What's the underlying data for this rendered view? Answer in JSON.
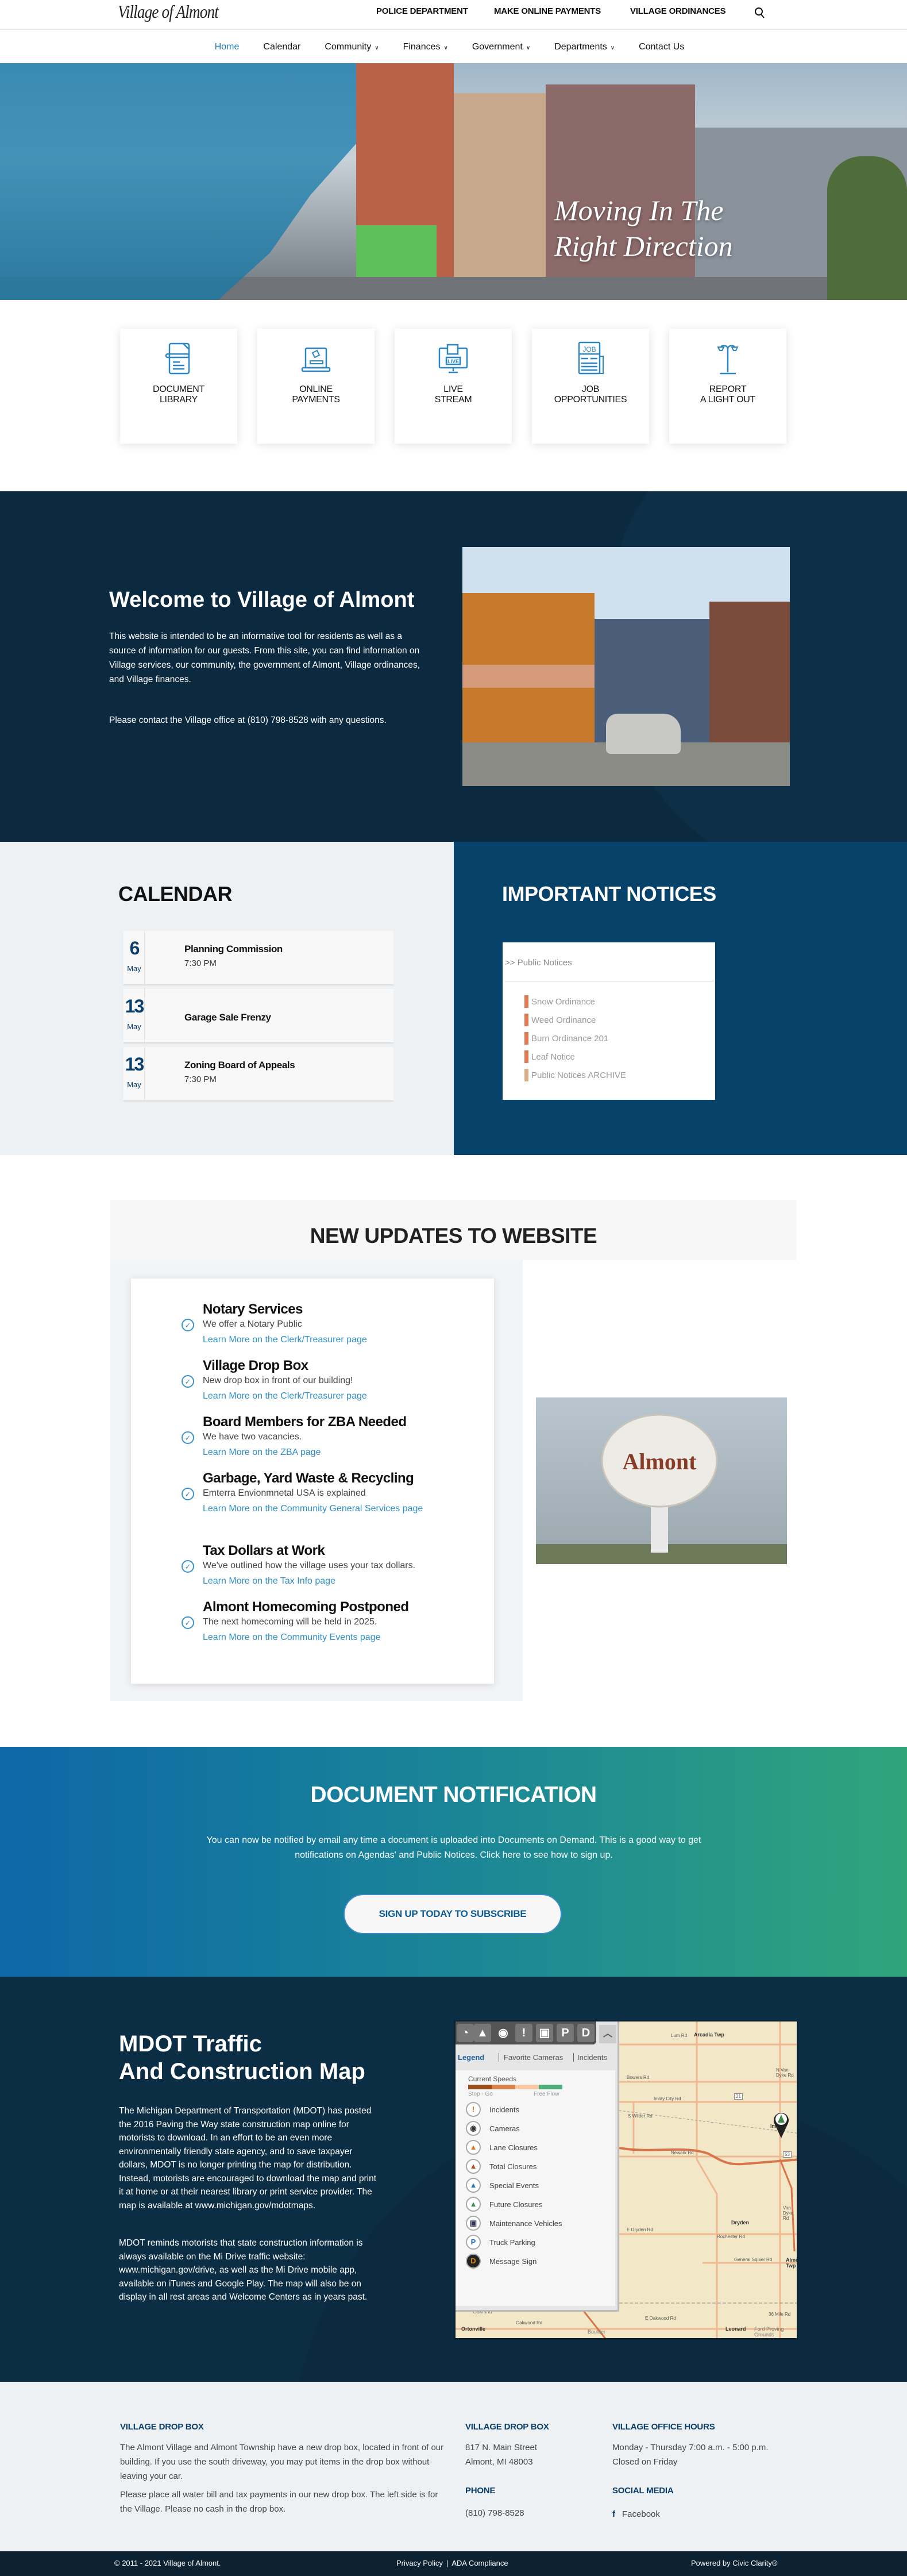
{
  "header": {
    "logo": "Village of Almont",
    "top_links": [
      "POLICE DEPARTMENT",
      "MAKE ONLINE PAYMENTS",
      "VILLAGE ORDINANCES"
    ],
    "search_icon": "search-icon"
  },
  "nav": {
    "items": [
      {
        "label": "Home",
        "active": true
      },
      {
        "label": "Calendar"
      },
      {
        "label": "Community",
        "dropdown": true
      },
      {
        "label": "Finances",
        "dropdown": true
      },
      {
        "label": "Government",
        "dropdown": true
      },
      {
        "label": "Departments",
        "dropdown": true
      },
      {
        "label": "Contact Us"
      }
    ]
  },
  "hero": {
    "line1": "Moving In The",
    "line2": "Right Direction"
  },
  "quick_links": [
    {
      "line1": "DOCUMENT",
      "line2": "LIBRARY",
      "icon": "document-icon"
    },
    {
      "line1": "ONLINE",
      "line2": "PAYMENTS",
      "icon": "laptop-payment-icon"
    },
    {
      "line1": "LIVE",
      "line2": "STREAM",
      "icon": "live-stream-icon"
    },
    {
      "line1": "JOB",
      "line2": "OPPORTUNITIES",
      "icon": "newspaper-job-icon",
      "icon_text": "JOB"
    },
    {
      "line1": "REPORT",
      "line2": "A LIGHT OUT",
      "icon": "street-light-icon"
    }
  ],
  "welcome": {
    "title": "Welcome to Village of Almont",
    "p1": "This website is intended to be an informative tool for residents as well as a source of information for our guests. From this site, you can find information on Village services, our community, the government of Almont, Village ordinances, and Village finances.",
    "p2": "Please contact the Village office at (810) 798-8528 with any questions."
  },
  "calendar": {
    "title": "CALENDAR",
    "events": [
      {
        "day": "6",
        "month": "May",
        "title": "Planning Commission",
        "time": "7:30 PM"
      },
      {
        "day": "13",
        "month": "May",
        "title": "Garage Sale Frenzy",
        "time": ""
      },
      {
        "day": "13",
        "month": "May",
        "title": "Zoning Board of Appeals",
        "time": "7:30 PM"
      }
    ]
  },
  "notices": {
    "title": "IMPORTANT NOTICES",
    "breadcrumb": ">> Public Notices",
    "items": [
      "Snow Ordinance",
      "Weed Ordinance",
      "Burn Ordinance 201",
      "Leaf Notice",
      "Public Notices ARCHIVE"
    ]
  },
  "updates": {
    "title": "NEW UPDATES TO WEBSITE",
    "items": [
      {
        "title": "Notary Services",
        "desc": "We offer a Notary Public",
        "link": "Learn More on the Clerk/Treasurer page"
      },
      {
        "title": "Village Drop Box",
        "desc": "New drop box in front of our building!",
        "link": "Learn More on the Clerk/Treasurer page"
      },
      {
        "title": "Board Members for ZBA Needed",
        "desc": "We have two vacancies.",
        "link": "Learn More on the ZBA page"
      },
      {
        "title": "Garbage, Yard Waste & Recycling",
        "desc": "Emterra Envionmnetal USA is explained",
        "link": "Learn More on the Community General Services page"
      },
      {
        "title": "Tax Dollars at Work",
        "desc": "We've outlined how the village uses your tax dollars.",
        "link": "Learn More on the Tax Info page"
      },
      {
        "title": "Almont Homecoming Postponed",
        "desc": "The next homecoming will be held in 2025.",
        "link": "Learn More on the Community Events page"
      }
    ],
    "tower_lettering": "Almont"
  },
  "doc_notification": {
    "title": "DOCUMENT NOTIFICATION",
    "text": "You can now be notified by email any time a document is uploaded into Documents on Demand. This is a good way to get notifications on Agendas' and Public Notices. Click here to see how to sign up.",
    "button": "SIGN UP TODAY TO SUBSCRIBE"
  },
  "mdot": {
    "title1": "MDOT Traffic",
    "title2": "And Construction Map",
    "p1": "The Michigan Department of Transportation (MDOT) has posted the 2016 Paving the Way state construction map online for motorists to download. In an effort to be an even more environmentally friendly state agency, and to save taxpayer dollars, MDOT is no longer printing the map for distribution. Instead, motorists are encouraged to download the map and print it at home or at their nearest library or print service provider. The map is available at www.michigan.gov/mdotmaps.",
    "p2": "MDOT reminds motorists that state construction information is always available on the Mi Drive traffic website: www.michigan.gov/drive, as well as the Mi Drive mobile app, available on iTunes and Google Play. The map will also be on display in all rest areas and Welcome Centers as in years past.",
    "map": {
      "tabs": [
        "Legend",
        "Favorite Cameras",
        "Incidents"
      ],
      "speeds_label": "Current Speeds",
      "speed_min": "Stop - Go",
      "speed_max": "Free Flow",
      "legend": [
        {
          "label": "Incidents",
          "glyph": "!",
          "color": "#e06a1c"
        },
        {
          "label": "Cameras",
          "glyph": "◉",
          "color": "#333"
        },
        {
          "label": "Lane Closures",
          "glyph": "▲",
          "color": "#e07a2c"
        },
        {
          "label": "Total Closures",
          "glyph": "▲",
          "color": "#b5501c"
        },
        {
          "label": "Special Events",
          "glyph": "▲",
          "color": "#2b7fc4"
        },
        {
          "label": "Future Closures",
          "glyph": "▲",
          "color": "#3b8a4c"
        },
        {
          "label": "Maintenance Vehicles",
          "glyph": "▣",
          "color": "#335"
        },
        {
          "label": "Truck Parking",
          "glyph": "P",
          "color": "#1e6fc0"
        },
        {
          "label": "Message Sign",
          "glyph": "D",
          "color": "#e08a1c"
        }
      ],
      "toolbar": [
        "P",
        "D"
      ],
      "places": [
        "Arcadia Twp",
        "Imlay",
        "Dryden",
        "Almont Twp",
        "Leonard",
        "Ortonville",
        "Oakland",
        "Boulder",
        "Ford Proving Grounds"
      ],
      "roads": [
        "Lum Rd",
        "Bowers Rd",
        "Imlay City Rd",
        "Newark Rd",
        "E Dryden Rd",
        "General Squier Rd",
        "E Oakwood Rd",
        "Oakwood Rd",
        "36 Mile Rd",
        "S Wilder Rd",
        "Rochester Rd",
        "N Van Dyke Rd",
        "Van Dyke Rd",
        "21",
        "53"
      ]
    }
  },
  "footer": {
    "col1": {
      "title": "VILLAGE DROP BOX",
      "p1": "The Almont Village and Almont Township have a new drop box, located in front of our building. If you use the south driveway, you may put items in the drop box without leaving your car.",
      "p2": "Please place all water bill and tax payments in our new drop box. The left side is for the Village. Please no cash in the drop box."
    },
    "col2": {
      "title": "VILLAGE DROP BOX",
      "line1": "817 N. Main Street",
      "line2": "Almont, MI 48003",
      "phone_title": "PHONE",
      "phone": "(810) 798-8528"
    },
    "col3": {
      "title": "VILLAGE OFFICE HOURS",
      "line1": "Monday - Thursday 7:00 a.m. - 5:00 p.m.",
      "line2": "Closed on Friday",
      "social_title": "SOCIAL MEDIA",
      "facebook": "Facebook"
    },
    "copyright": "© 2011 - 2021 Village of Almont.",
    "privacy": "Privacy Policy",
    "sep": "|",
    "ada": "ADA Compliance",
    "powered": "Powered by Civic Clarity®"
  },
  "colors": {
    "accent": "#1e7ab8",
    "navy": "#0b2a40",
    "notices_bg": "#06426a",
    "gradient_start": "#0d67a8",
    "gradient_end": "#2fa57c"
  }
}
